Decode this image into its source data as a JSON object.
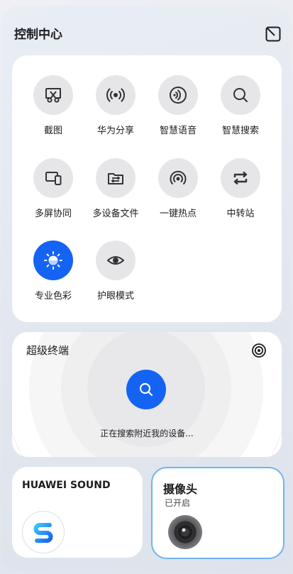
{
  "header": {
    "title": "控制中心",
    "edit_icon": "edit-square-icon"
  },
  "toggles": [
    {
      "label": "截图",
      "icon": "screenshot-scissors-icon",
      "active": false
    },
    {
      "label": "华为分享",
      "icon": "share-broadcast-icon",
      "active": false
    },
    {
      "label": "智慧语音",
      "icon": "voice-wave-icon",
      "active": false
    },
    {
      "label": "智慧搜索",
      "icon": "search-icon",
      "active": false
    },
    {
      "label": "多屏协同",
      "icon": "multi-screen-icon",
      "active": false
    },
    {
      "label": "多设备文件",
      "icon": "folder-transfer-icon",
      "active": false
    },
    {
      "label": "一键热点",
      "icon": "hotspot-icon",
      "active": false
    },
    {
      "label": "中转站",
      "icon": "relay-swap-icon",
      "active": false
    },
    {
      "label": "专业色彩",
      "icon": "brightness-icon",
      "active": true
    },
    {
      "label": "护眼模式",
      "icon": "eye-icon",
      "active": false
    }
  ],
  "super_device": {
    "title": "超级终端",
    "status": "正在搜索附近我的设备...",
    "target_icon": "target-icon",
    "search_icon": "search-icon"
  },
  "sound_card": {
    "title": "HUAWEI SOUND",
    "logo_icon": "huawei-sound-logo-icon"
  },
  "camera_card": {
    "title": "摄像头",
    "status": "已开启",
    "icon": "camera-lens-icon"
  },
  "colors": {
    "accent": "#1463f3",
    "tile_bg": "#e6e6e8",
    "camera_border": "#6fb4ee"
  }
}
